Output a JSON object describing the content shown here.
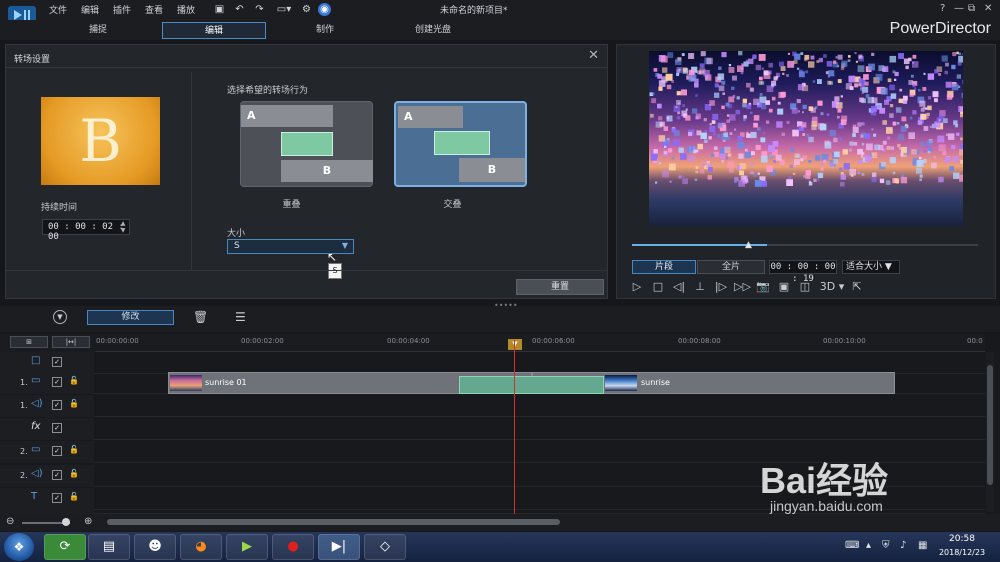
{
  "menubar": {
    "items": [
      "文件",
      "编辑",
      "插件",
      "查看",
      "播放"
    ],
    "title": "未命名的新项目*",
    "win_buttons": [
      "?",
      "—",
      "⧉",
      "✕"
    ]
  },
  "modes": {
    "tabs": [
      "捕捉",
      "编辑",
      "制作",
      "创建光盘"
    ],
    "active": 1
  },
  "brand": "PowerDirector",
  "dialog": {
    "title": "转场设置",
    "close": "✕",
    "thumb_letter": "B",
    "duration_label": "持续时间",
    "duration_value": "00 : 00 : 02 : 00",
    "behavior_label": "选择希望的转场行为",
    "options": [
      {
        "label": "重叠",
        "a": "A",
        "b": "B"
      },
      {
        "label": "交叠",
        "a": "A",
        "b": "B",
        "selected": true
      }
    ],
    "size_label": "大小",
    "size_value": "S",
    "tooltip": "S",
    "reset_label": "重置"
  },
  "preview": {
    "segments": [
      "片段",
      "全片"
    ],
    "active_segment": 0,
    "time": "00 : 00 : 00 : 19",
    "fit": "适合大小",
    "fit_arrow": "▼",
    "scrub_position": 0.39,
    "buttons": [
      "▷",
      "□",
      "◁|",
      "⊥",
      "|▷",
      "▷▷",
      "📷",
      "▣",
      "◫",
      "3D ▾",
      "⇱"
    ]
  },
  "toolbar": {
    "modify_label": "修改"
  },
  "timeline": {
    "ruler": [
      "00:00:00:00",
      "00:00:02:00",
      "00:00:04:00",
      "00:00:06:00",
      "00:00:08:00",
      "00:00:10:00",
      "00:0"
    ],
    "tracks": [
      {
        "num": "",
        "icon": "□"
      },
      {
        "num": "1.",
        "icon": "▭"
      },
      {
        "num": "1.",
        "icon": "◁)"
      },
      {
        "num": "",
        "icon": "fx"
      },
      {
        "num": "2.",
        "icon": "▭"
      },
      {
        "num": "2.",
        "icon": "◁)"
      },
      {
        "num": "",
        "icon": "T"
      },
      {
        "num": "",
        "icon": ""
      }
    ],
    "clips": [
      {
        "label": "sunrise 01"
      },
      {
        "label": "sunrise"
      }
    ]
  },
  "taskbar": {
    "clock_time": "20:58",
    "clock_date": "2018/12/23"
  },
  "watermark": {
    "text": "Bai经验",
    "sub": "jingyan.baidu.com"
  }
}
